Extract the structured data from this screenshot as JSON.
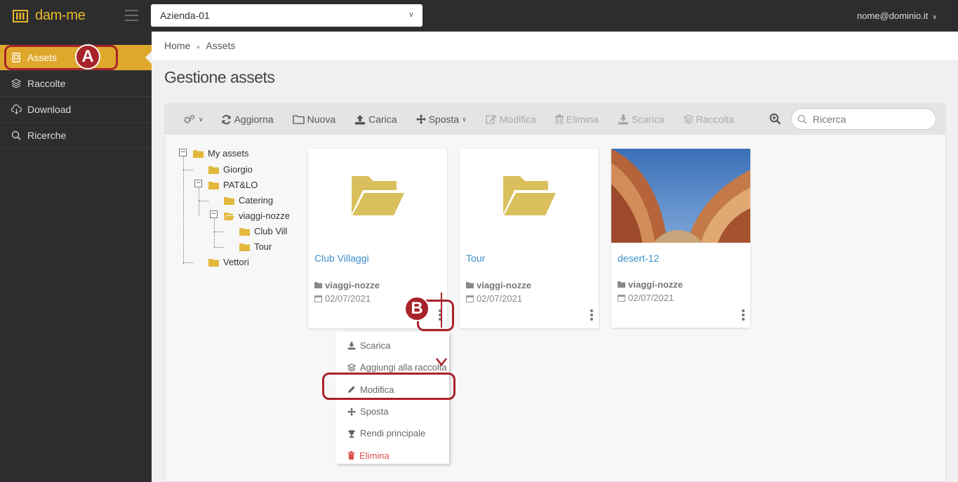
{
  "app": {
    "logo_text": "dam-me",
    "brand_color": "#dfa82d",
    "company": "Azienda-01",
    "user": "nome@dominio.it"
  },
  "sidebar": {
    "items": [
      {
        "label": "Assets",
        "icon": "assets-icon",
        "active": true
      },
      {
        "label": "Raccolte",
        "icon": "layers-icon"
      },
      {
        "label": "Download",
        "icon": "cloud-download-icon"
      },
      {
        "label": "Ricerche",
        "icon": "search-icon"
      }
    ]
  },
  "breadcrumb": [
    "Home",
    "Assets"
  ],
  "page_title": "Gestione assets",
  "toolbar": {
    "aggiorna": "Aggiorna",
    "nuova": "Nuova",
    "carica": "Carica",
    "sposta": "Sposta",
    "modifica": "Modifica",
    "elimina": "Elimina",
    "scarica": "Scarica",
    "raccolta": "Raccolta"
  },
  "search": {
    "placeholder": "Ricerca"
  },
  "tree": {
    "root": "My assets",
    "giorgio": "Giorgio",
    "patlo": "PAT&LO",
    "catering": "Catering",
    "viaggi": "viaggi-nozze",
    "club": "Club Vill",
    "tour": "Tour",
    "vettori": "Vettori"
  },
  "cards": [
    {
      "title": "Club Villaggi",
      "folder": "viaggi-nozze",
      "date": "02/07/2021"
    },
    {
      "title": "Tour",
      "folder": "viaggi-nozze",
      "date": "02/07/2021"
    },
    {
      "title": "desert-12",
      "folder": "viaggi-nozze",
      "date": "02/07/2021"
    }
  ],
  "context_menu": {
    "scarica": "Scarica",
    "aggiungi": "Aggiungi alla raccolta",
    "modifica": "Modifica",
    "sposta": "Sposta",
    "principale": "Rendi principale",
    "elimina": "Elimina"
  },
  "annotations": {
    "a": "A",
    "b": "B"
  }
}
